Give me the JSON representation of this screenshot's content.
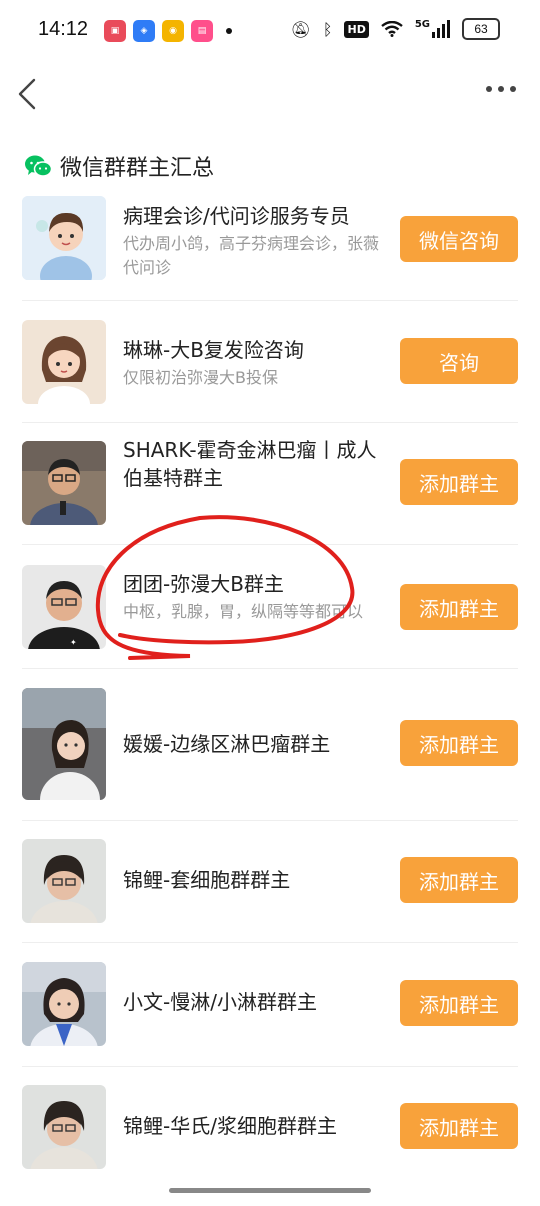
{
  "status_bar": {
    "time": "14:12",
    "battery": "63",
    "network": "5G",
    "hd": "HD"
  },
  "nav": {
    "back_icon": "chevron-left-icon",
    "more_icon": "more-dots-icon"
  },
  "section": {
    "title": "微信群群主汇总",
    "icon": "wechat-icon",
    "accent": "#07c160"
  },
  "button_color": "#f8a23b",
  "items": [
    {
      "name": "病理会诊/代问诊服务专员",
      "desc": "代办周小鸽，高子芬病理会诊，张薇代问诊",
      "button": "微信咨询"
    },
    {
      "name": "琳琳-大B复发险咨询",
      "desc": "仅限初治弥漫大B投保",
      "button": "咨询"
    },
    {
      "name": "SHARK-霍奇金淋巴瘤丨成人伯基特群主",
      "desc": "",
      "button": "添加群主"
    },
    {
      "name": "团团-弥漫大B群主",
      "desc": "中枢，乳腺，胃，纵隔等等都可以",
      "button": "添加群主"
    },
    {
      "name": "媛媛-边缘区淋巴瘤群主",
      "desc": "",
      "button": "添加群主"
    },
    {
      "name": "锦鲤-套细胞群群主",
      "desc": "",
      "button": "添加群主"
    },
    {
      "name": "小文-慢淋/小淋群群主",
      "desc": "",
      "button": "添加群主"
    },
    {
      "name": "锦鲤-华氏/浆细胞群群主",
      "desc": "",
      "button": "添加群主"
    }
  ]
}
